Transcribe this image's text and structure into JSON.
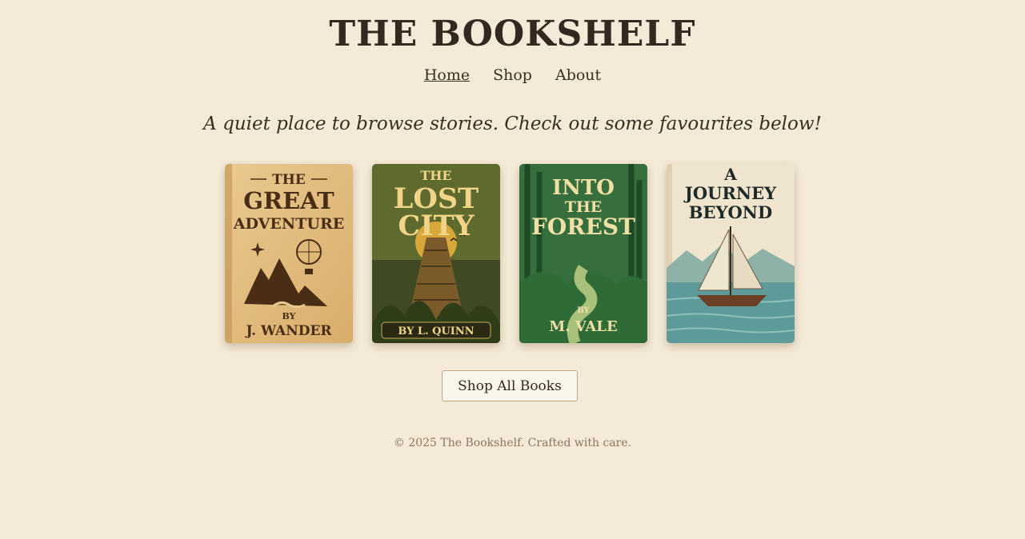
{
  "site": {
    "title": "THE BOOKSHELF"
  },
  "nav": {
    "items": [
      {
        "label": "Home",
        "active": true
      },
      {
        "label": "Shop",
        "active": false
      },
      {
        "label": "About",
        "active": false
      }
    ]
  },
  "tagline": "A quiet place to browse stories. Check out some favourites below!",
  "books": [
    {
      "title_lines": [
        "THE",
        "GREAT",
        "ADVENTURE"
      ],
      "by": "BY",
      "author": "J. WANDER"
    },
    {
      "title_lines": [
        "THE",
        "LOST",
        "CITY"
      ],
      "author_line": "BY L. QUINN"
    },
    {
      "title_lines": [
        "INTO",
        "THE",
        "FOREST"
      ],
      "by": "BY",
      "author": "M. VALE"
    },
    {
      "title_lines": [
        "A",
        "JOURNEY",
        "BEYOND"
      ]
    }
  ],
  "cta": {
    "label": "Shop All Books"
  },
  "footer": {
    "text": "© 2025 The Bookshelf. Crafted with care."
  },
  "colors": {
    "background": "#f4ead7",
    "text": "#33291f",
    "muted": "#8a7760"
  }
}
